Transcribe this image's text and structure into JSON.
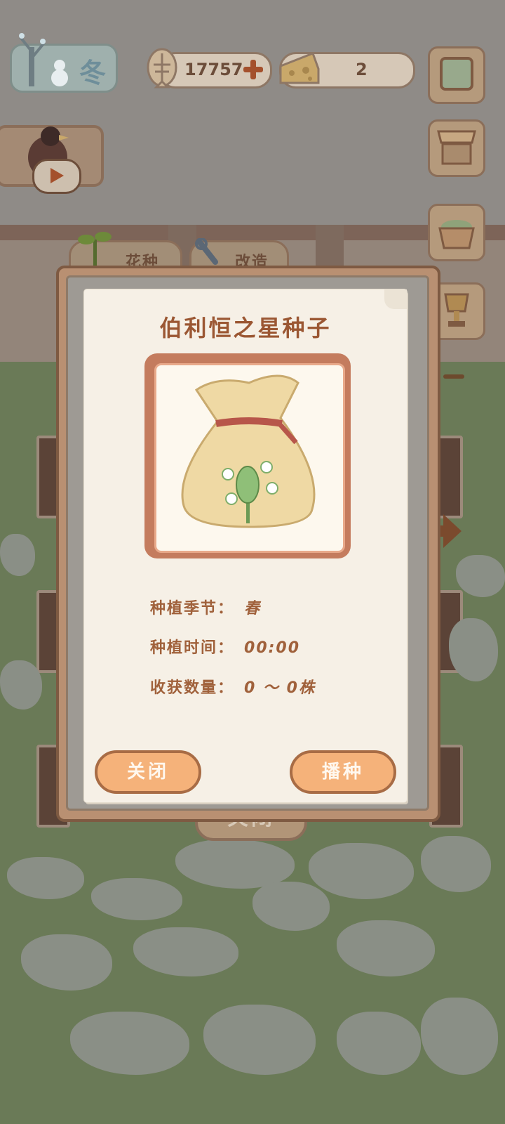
{
  "hud": {
    "season": "冬",
    "fish_currency": "17757",
    "cheese_currency": "2"
  },
  "tabs": [
    {
      "label": "花种"
    },
    {
      "label": "改造"
    }
  ],
  "background_close_label": "关闭",
  "seed_dialog": {
    "title": "伯利恒之星种子",
    "season_label": "种植季节：",
    "season_value": "春",
    "time_label": "种植时间：",
    "time_value": "00:00",
    "harvest_label": "收获数量：",
    "harvest_value": "0 ～ 0株",
    "close_button": "关闭",
    "sow_button": "播种"
  },
  "colors": {
    "title": "#9b5733",
    "button_fill": "#f5b27a",
    "button_border": "#a86c45",
    "paper": "#f6f0e6"
  }
}
